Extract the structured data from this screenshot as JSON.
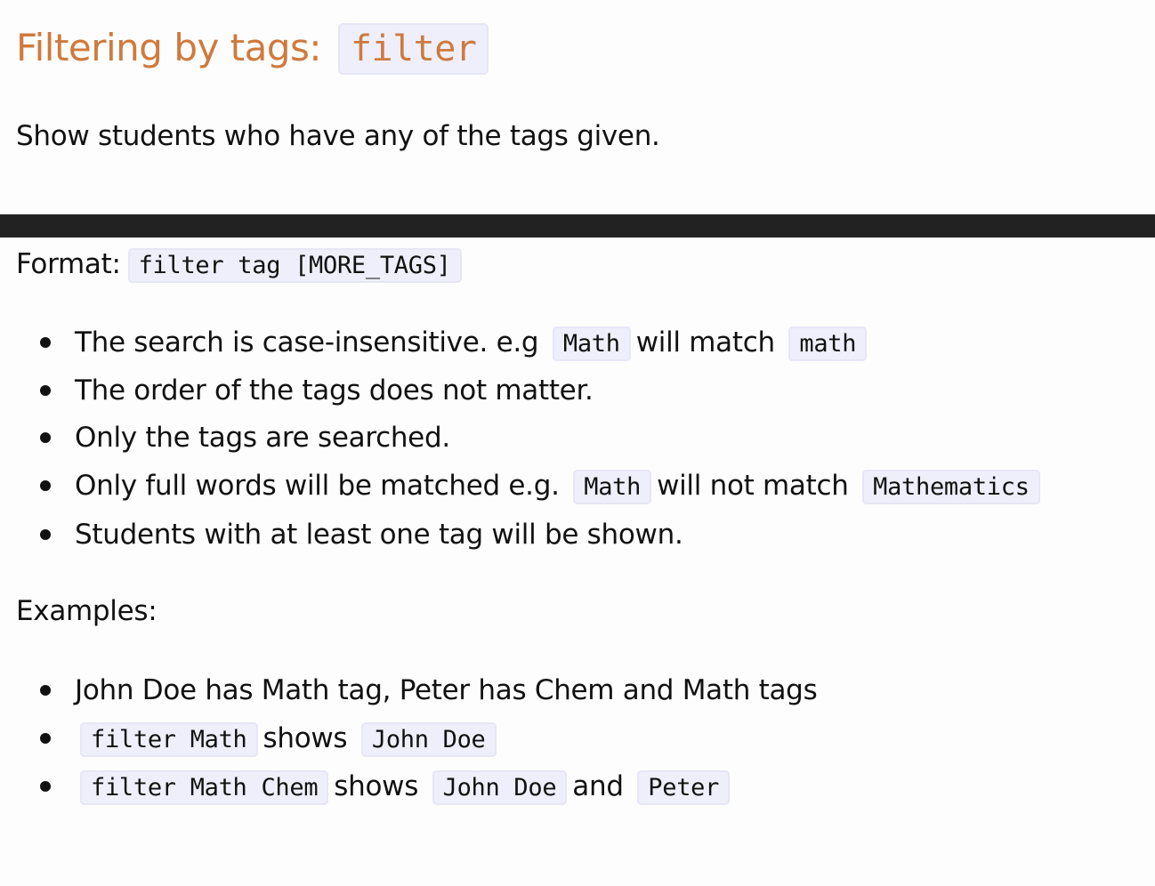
{
  "heading": {
    "text": "Filtering by tags:",
    "command": "filter"
  },
  "description": "Show students who have any of the tags given.",
  "format": {
    "label": "Format:",
    "syntax": "filter tag [MORE_TAGS]"
  },
  "notes": [
    {
      "text_1": "The search is case-insensitive. e.g",
      "code_1": "Math",
      "text_2": "will match",
      "code_2": "math"
    },
    {
      "text_1": "The order of the tags does not matter."
    },
    {
      "text_1": "Only the tags are searched."
    },
    {
      "text_1": "Only full words will be matched e.g.",
      "code_1": "Math",
      "text_2": "will not match",
      "code_2": "Mathematics"
    },
    {
      "text_1": "Students with at least one tag will be shown."
    }
  ],
  "examples_label": "Examples:",
  "examples": [
    {
      "text_1": "John Doe has Math tag, Peter has Chem and Math tags"
    },
    {
      "code_1": "filter Math",
      "text_2": "shows",
      "code_2": "John Doe"
    },
    {
      "code_1": "filter Math Chem",
      "text_2": "shows",
      "code_2": "John Doe",
      "text_3": "and",
      "code_3": "Peter"
    }
  ],
  "colors": {
    "heading": "#cf7a3d",
    "code_background": "#efeffc",
    "rule": "#222222"
  }
}
